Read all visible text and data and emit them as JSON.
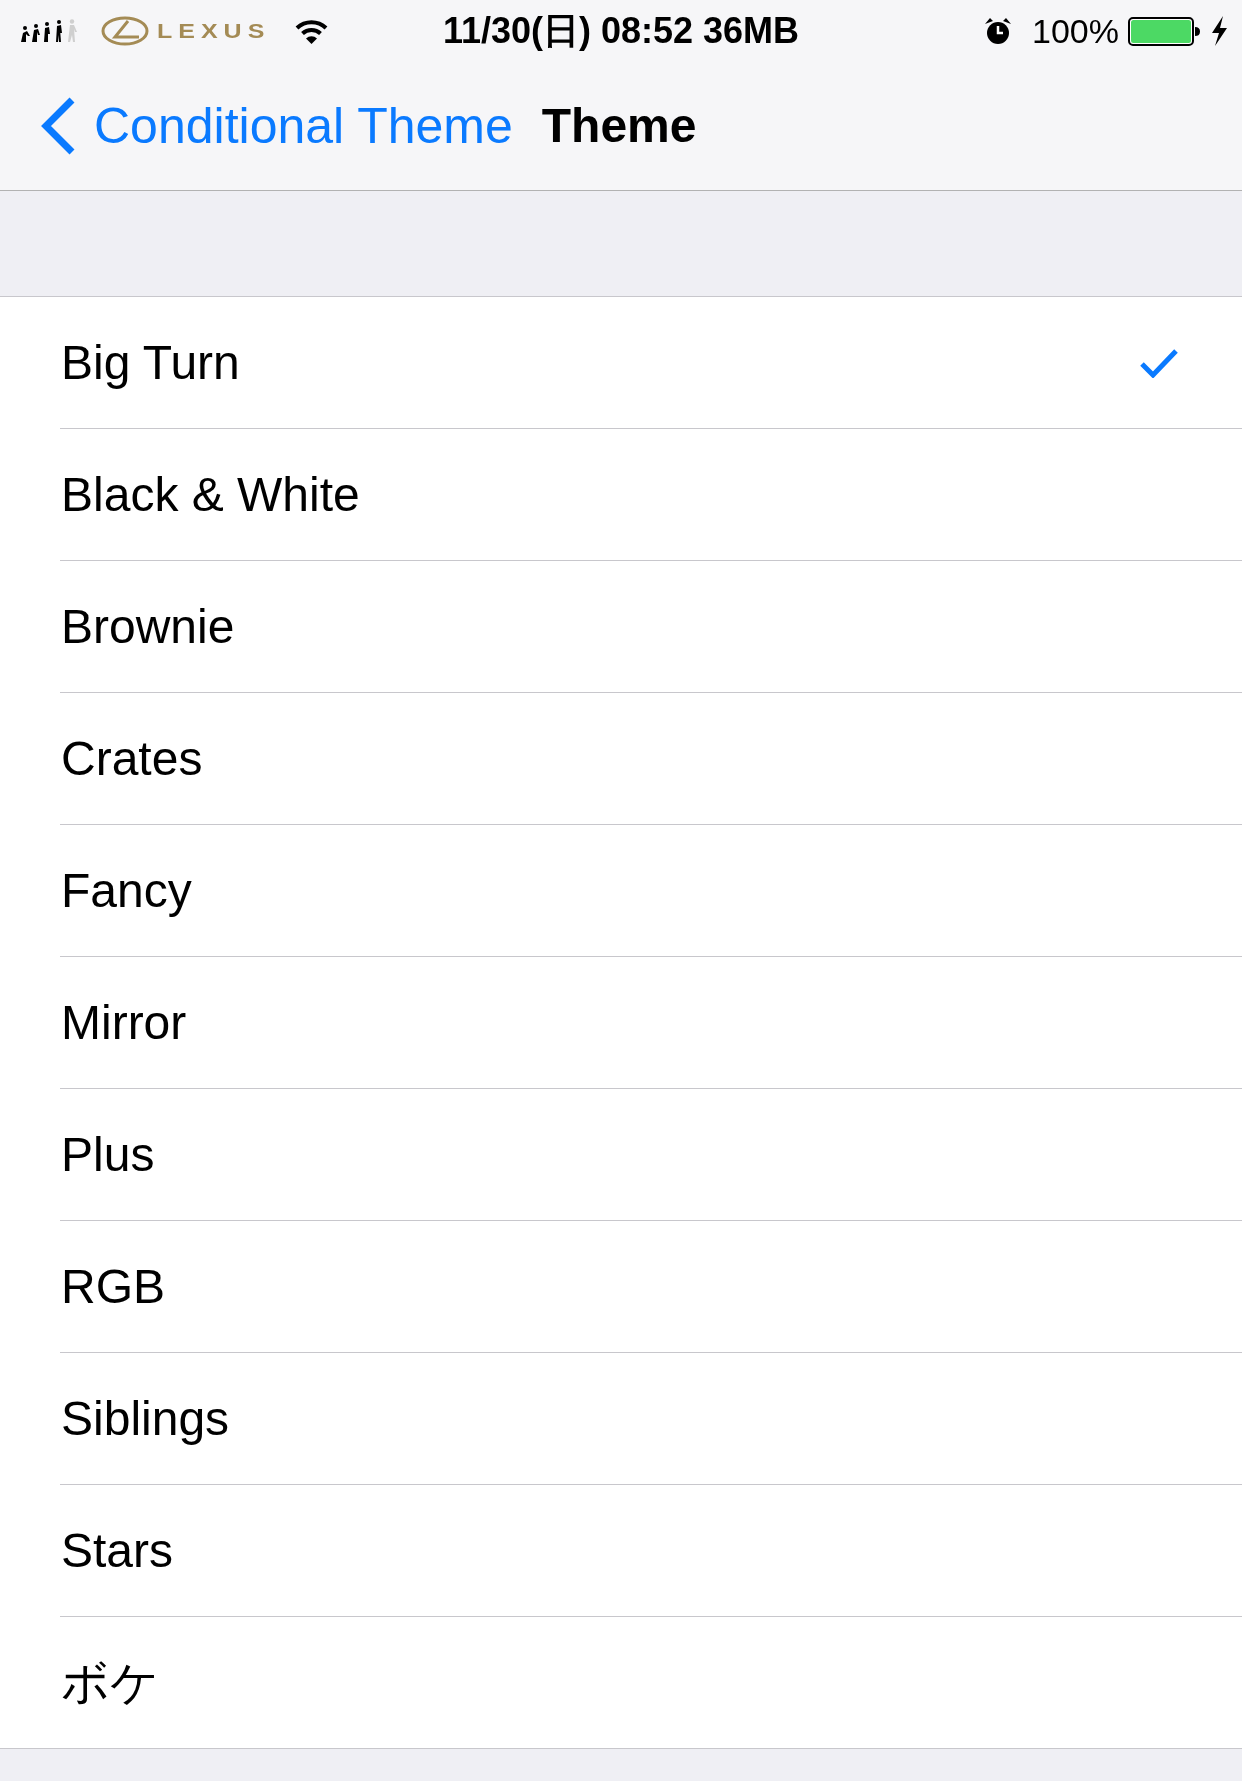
{
  "status_bar": {
    "logo_text": "LEXUS",
    "time": "11/30(日) 08:52 36MB",
    "battery_percent": "100%"
  },
  "nav_bar": {
    "back_label": "Conditional Theme",
    "title": "Theme"
  },
  "themes": [
    {
      "label": "Big Turn",
      "selected": true
    },
    {
      "label": "Black & White",
      "selected": false
    },
    {
      "label": "Brownie",
      "selected": false
    },
    {
      "label": "Crates",
      "selected": false
    },
    {
      "label": "Fancy",
      "selected": false
    },
    {
      "label": "Mirror",
      "selected": false
    },
    {
      "label": "Plus",
      "selected": false
    },
    {
      "label": "RGB",
      "selected": false
    },
    {
      "label": "Siblings",
      "selected": false
    },
    {
      "label": "Stars",
      "selected": false
    },
    {
      "label": "ボケ",
      "selected": false
    }
  ]
}
